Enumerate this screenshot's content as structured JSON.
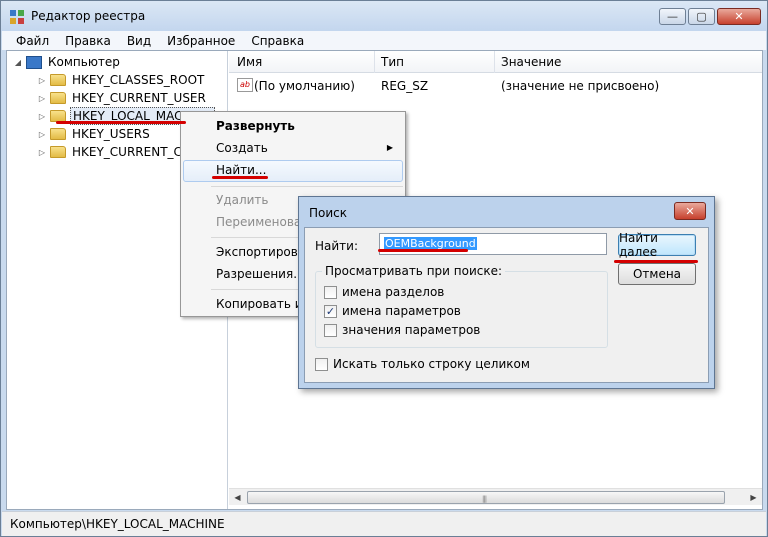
{
  "window": {
    "title": "Редактор реестра",
    "controls": {
      "minimize": "—",
      "maximize": "▢",
      "close": "✕"
    }
  },
  "menubar": [
    "Файл",
    "Правка",
    "Вид",
    "Избранное",
    "Справка"
  ],
  "tree": {
    "root": "Компьютер",
    "items": [
      "HKEY_CLASSES_ROOT",
      "HKEY_CURRENT_USER",
      "HKEY_LOCAL_MACHINE",
      "HKEY_USERS",
      "HKEY_CURRENT_CO"
    ]
  },
  "list": {
    "columns": [
      "Имя",
      "Тип",
      "Значение"
    ],
    "rows": [
      {
        "name": "(По умолчанию)",
        "type": "REG_SZ",
        "value": "(значение не присвоено)"
      }
    ],
    "icon_text": "ab"
  },
  "statusbar": {
    "path": "Компьютер\\HKEY_LOCAL_MACHINE"
  },
  "context_menu": {
    "items": [
      "Развернуть",
      "Создать",
      "Найти...",
      "Удалить",
      "Переименовать",
      "Экспортироват",
      "Разрешения...",
      "Копировать им"
    ]
  },
  "find_dialog": {
    "title": "Поиск",
    "find_label": "Найти:",
    "find_value": "OEMBackground",
    "find_next": "Найти далее",
    "cancel": "Отмена",
    "group_title": "Просматривать при поиске:",
    "options": [
      {
        "label": "имена разделов",
        "checked": false
      },
      {
        "label": "имена параметров",
        "checked": true
      },
      {
        "label": "значения параметров",
        "checked": false
      }
    ],
    "whole_string": {
      "label": "Искать только строку целиком",
      "checked": false
    }
  },
  "annotation_color": "#d40000"
}
